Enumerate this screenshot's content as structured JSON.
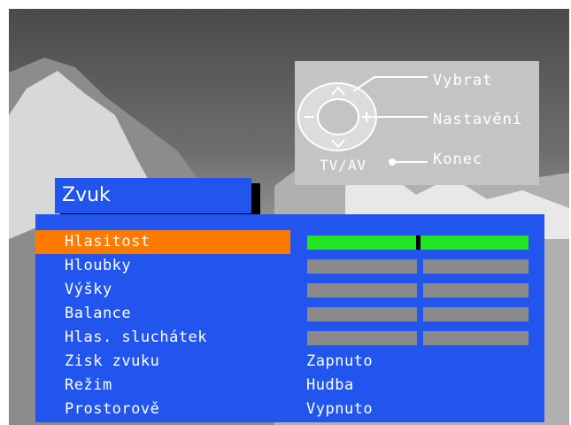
{
  "help": {
    "select_label": "Vybrat",
    "adjust_label": "Nastavění",
    "exit_label": "Konec",
    "tvav_label": "TV/AV"
  },
  "menu": {
    "title": "Zvuk",
    "items": [
      {
        "label": "Hlasitost",
        "kind": "slider",
        "level": 0.5,
        "active": true
      },
      {
        "label": "Hloubky",
        "kind": "slider",
        "level": 0.5
      },
      {
        "label": "Výšky",
        "kind": "slider",
        "level": 0.5
      },
      {
        "label": "Balance",
        "kind": "slider",
        "level": 0.5
      },
      {
        "label": "Hlas. sluchátek",
        "kind": "slider",
        "level": 0.5
      },
      {
        "label": "Zisk zvuku",
        "kind": "value",
        "value": "Zapnuto"
      },
      {
        "label": "Režim",
        "kind": "value",
        "value": "Hudba"
      },
      {
        "label": "Prostorově",
        "kind": "value",
        "value": "Vypnuto"
      }
    ]
  },
  "colors": {
    "menu_bg": "#2255ee",
    "highlight": "#ff7a00",
    "volume_bar": "#22e622",
    "inactive_bar": "#8a8a8a"
  }
}
